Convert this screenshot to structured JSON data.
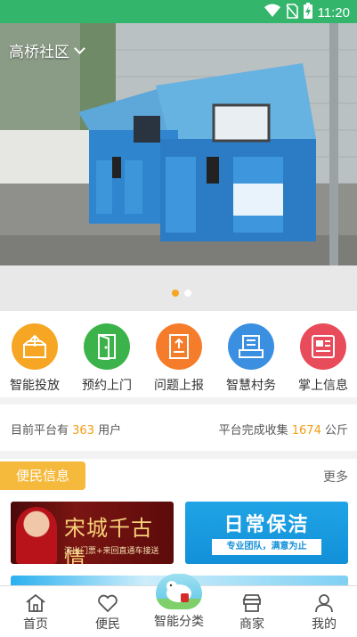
{
  "status_bar": {
    "time": "11:20",
    "icons": [
      "wifi-icon",
      "no-sim-icon",
      "battery-charging-icon"
    ]
  },
  "banner": {
    "community": "高桥社区",
    "slide_count": 2,
    "active_slide": 1
  },
  "features": [
    {
      "label": "智能投放",
      "icon": "box-upload-icon",
      "color": "#f6a623"
    },
    {
      "label": "预约上门",
      "icon": "door-icon",
      "color": "#3cb34a"
    },
    {
      "label": "问题上报",
      "icon": "report-upload-icon",
      "color": "#f57c2b"
    },
    {
      "label": "智慧村务",
      "icon": "document-list-icon",
      "color": "#3a8fe0"
    },
    {
      "label": "掌上信息",
      "icon": "news-icon",
      "color": "#e84b5a"
    }
  ],
  "stats": {
    "left_prefix": "目前平台有",
    "users": "363",
    "left_suffix": "用户",
    "right_prefix": "平台完成收集",
    "collected": "1674",
    "right_suffix": "公斤"
  },
  "info": {
    "section_title": "便民信息",
    "more": "更多",
    "ads": [
      {
        "title": "宋城千古情",
        "subtitle": "演出门票+来回直通车接送"
      },
      {
        "title": "日常保洁",
        "subtitle": "专业团队，满意为止"
      }
    ]
  },
  "tabbar": [
    {
      "label": "首页",
      "icon": "home-icon"
    },
    {
      "label": "便民",
      "icon": "heart-icon"
    },
    {
      "label": "智能分类",
      "icon": "sheep-mascot-icon"
    },
    {
      "label": "商家",
      "icon": "store-icon"
    },
    {
      "label": "我的",
      "icon": "user-icon"
    }
  ]
}
